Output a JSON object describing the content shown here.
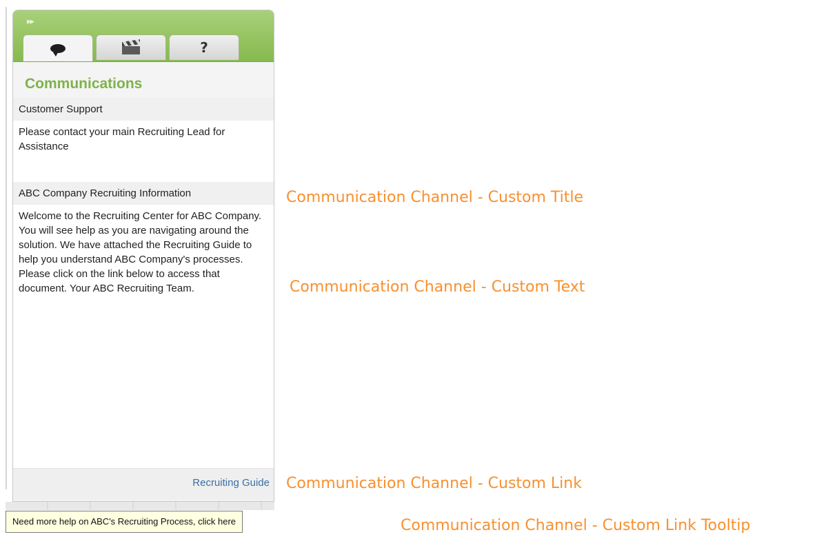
{
  "panel": {
    "collapse_glyph": "▸▸",
    "tabs": [
      {
        "name": "communications",
        "icon": "speech-bubble-icon"
      },
      {
        "name": "media",
        "icon": "clapperboard-icon"
      },
      {
        "name": "help",
        "icon": "question-mark-icon",
        "label": "?"
      }
    ],
    "title": "Communications",
    "sections": [
      {
        "title": "Customer Support",
        "text": "Please contact your main Recruiting Lead for Assistance"
      },
      {
        "title": "ABC Company Recruiting Information",
        "text": "Welcome to the Recruiting Center for ABC Company.  You will see help as you are navigating around the solution.  We have attached the Recruiting Guide to help you understand ABC Company's processes.  Please click on the link below to access that document.  Your ABC Recruiting Team."
      }
    ],
    "link_label": "Recruiting Guide"
  },
  "tooltip": "Need more help on ABC's Recruiting Process, click here",
  "annotations": {
    "title": "Communication Channel - Custom Title",
    "text": "Communication Channel - Custom Text",
    "link": "Communication Channel - Custom Link",
    "tooltip": "Communication Channel - Custom Link Tooltip"
  },
  "colors": {
    "header_green": "#86ba4e",
    "title_green": "#7eb24a",
    "link_blue": "#3a6fa6",
    "annotation_orange": "#f7902f",
    "tooltip_bg": "#ffffe1"
  }
}
